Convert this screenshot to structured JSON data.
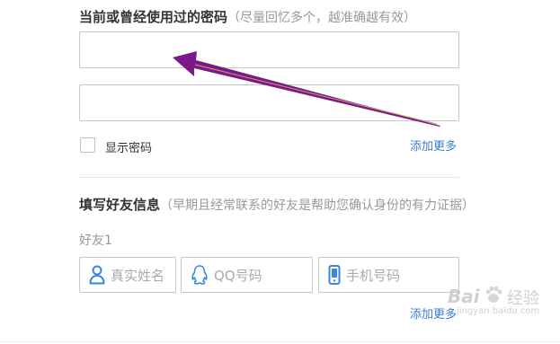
{
  "password_section": {
    "heading": "当前或曾经使用过的密码",
    "hint": "（尽量回忆多个，越准确越有效）",
    "show_password_label": "显示密码",
    "add_more_label": "添加更多"
  },
  "friends_section": {
    "heading": "填写好友信息",
    "hint": "（早期且经常联系的好友是帮助您确认身份的有力证据）",
    "friend_label": "好友1",
    "real_name_placeholder": "真实姓名",
    "qq_placeholder": "QQ号码",
    "phone_placeholder": "手机号码",
    "add_more_label": "添加更多"
  },
  "watermark": {
    "brand": "Bai",
    "brand_suffix": "经验",
    "url": "jingyan.baidu.com"
  },
  "colors": {
    "arrow": "#7a1a8a",
    "link": "#3a7bd5",
    "icon_blue": "#3a86e0"
  },
  "icons": [
    "person-icon",
    "qq-penguin-icon",
    "phone-icon",
    "baidu-paw-icon",
    "annotation-arrow"
  ]
}
